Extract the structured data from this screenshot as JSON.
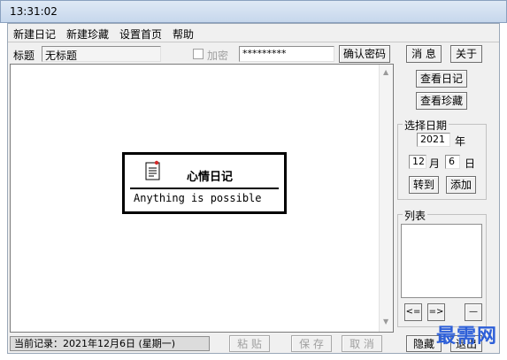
{
  "window": {
    "title": "13:31:02"
  },
  "menu": [
    "新建日记",
    "新建珍藏",
    "设置首页",
    "帮助"
  ],
  "toolbar": {
    "title_label": "标题",
    "title_value": "无标题",
    "encrypt_label": "加密",
    "password_value": "*********",
    "confirm_password_button": "确认密码"
  },
  "right_panel": {
    "message_button": "消 息",
    "about_button": "关于",
    "view_diary_button": "查看日记",
    "view_collection_button": "查看珍藏",
    "date_group_label": "选择日期",
    "year_value": "2021",
    "year_unit": "年",
    "month_value": "12",
    "month_unit": "月",
    "day_value": "6",
    "day_unit": "日",
    "goto_button": "转到",
    "add_button": "添加",
    "list_group_label": "列表",
    "prev_button": "<=",
    "next_button": "=>",
    "minus_button": "—"
  },
  "editor": {
    "card_title": "心情日记",
    "card_motto": "Anything is possible"
  },
  "status_bar": {
    "current_record": "当前记录：2021年12月6日 (星期一)",
    "paste_button": "粘 贴",
    "save_button": "保 存",
    "cancel_button": "取 消",
    "hide_button": "隐藏",
    "exit_button": "退出"
  },
  "watermark": "最需网"
}
